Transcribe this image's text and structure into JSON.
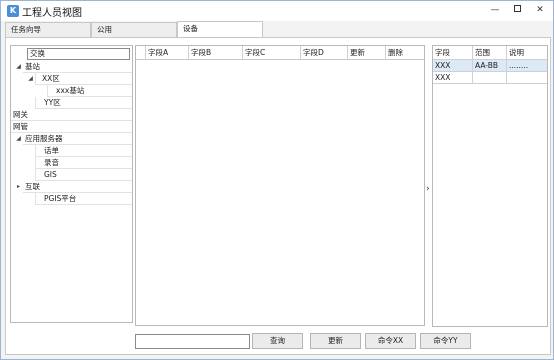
{
  "window": {
    "title": "工程人员视图",
    "icon_glyph": "K",
    "minimize": "—",
    "close": "✕"
  },
  "tabs": [
    {
      "label": "任务向导",
      "active": false
    },
    {
      "label": "公用",
      "active": false
    },
    {
      "label": "设备",
      "active": true
    }
  ],
  "tree": {
    "search_value": "交换",
    "expanded_glyph": "◢",
    "collapsed_glyph": "▸",
    "items": [
      {
        "label": "基站"
      },
      {
        "label": "XX区"
      },
      {
        "label": "xxx基站"
      },
      {
        "label": "YY区"
      },
      {
        "label": "网关"
      },
      {
        "label": "网管"
      },
      {
        "label": "应用服务器"
      },
      {
        "label": "话单"
      },
      {
        "label": "录音"
      },
      {
        "label": "GIS"
      },
      {
        "label": "互联"
      },
      {
        "label": "PGIS平台"
      }
    ]
  },
  "grid": {
    "columns": [
      "",
      "字段A",
      "字段B",
      "字段C",
      "字段D",
      "更新",
      "删除"
    ]
  },
  "collapse_arrow": "›",
  "properties": {
    "columns": [
      "字段",
      "范围",
      "说明"
    ],
    "rows": [
      [
        "XXX",
        "AA-BB",
        "........"
      ],
      [
        "XXX",
        "",
        ""
      ]
    ]
  },
  "bottom": {
    "input_value": "",
    "buttons": [
      "查询",
      "更新",
      "命令XX",
      "命令YY"
    ]
  }
}
